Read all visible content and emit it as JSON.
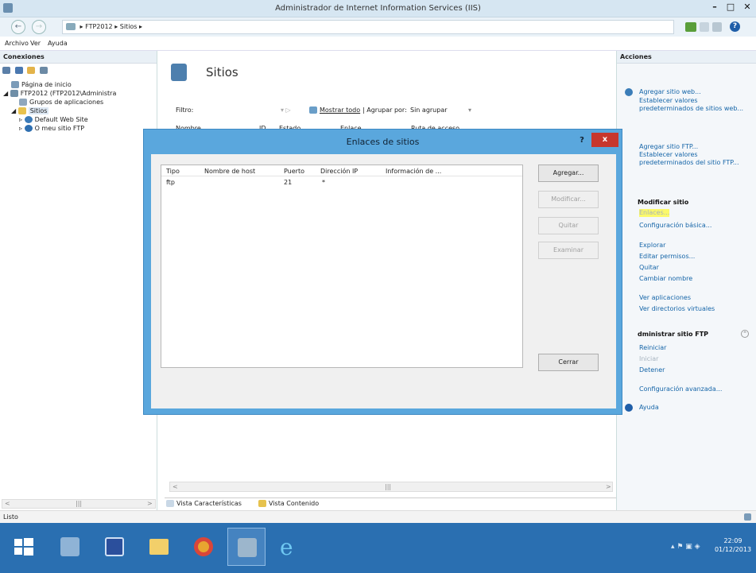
{
  "window": {
    "title": "Administrador de Internet Information Services (IIS)"
  },
  "address": {
    "segments": [
      "FTP2012",
      "Sitios"
    ]
  },
  "menu": [
    "Archivo",
    "Ver",
    "Ayuda"
  ],
  "connections": {
    "header": "Conexiones",
    "tree": [
      "Página de inicio",
      "FTP2012 (FTP2012\\Administra",
      "Grupos de aplicaciones",
      "Sitios",
      "Default Web Site",
      "O meu sitio FTP"
    ]
  },
  "center": {
    "title": "Sitios",
    "filter_label": "Filtro:",
    "show_all": "Mostrar todo",
    "group_by_label": "| Agrupar por:",
    "group_by_value": "Sin agrupar",
    "columns": [
      "Nombre",
      "ID",
      "Estado",
      "Enlace",
      "Ruta de acceso"
    ],
    "tabs": [
      "Vista Características",
      "Vista Contenido"
    ]
  },
  "dialog": {
    "title": "Enlaces de sitios",
    "help": "?",
    "close": "x",
    "columns": [
      "Tipo",
      "Nombre de host",
      "Puerto",
      "Dirección IP",
      "Información de ..."
    ],
    "rows": [
      {
        "type": "ftp",
        "host": "",
        "port": "21",
        "ip": "*",
        "info": ""
      }
    ],
    "buttons": {
      "add": "Agregar...",
      "edit": "Modificar...",
      "remove": "Quitar",
      "browse": "Examinar",
      "close": "Cerrar"
    }
  },
  "actions": {
    "header": "Acciones",
    "add_site": "Agregar sitio web...",
    "web_defaults": "Establecer valores predeterminados de sitios web...",
    "add_ftp": "Agregar sitio FTP...",
    "ftp_defaults": "Establecer valores predeterminados del sitio FTP...",
    "edit_site_header": "Modificar sitio",
    "bindings": "Enlaces...",
    "basic_settings": "Configuración básica...",
    "explore": "Explorar",
    "edit_permissions": "Editar permisos...",
    "remove": "Quitar",
    "rename": "Cambiar nombre",
    "view_apps": "Ver aplicaciones",
    "view_vdirs": "Ver directorios virtuales",
    "manage_ftp_header": "dministrar sitio FTP",
    "restart": "Reiniciar",
    "start": "Iniciar",
    "stop": "Detener",
    "advanced_settings": "Configuración avanzada...",
    "help": "Ayuda"
  },
  "status": {
    "text": "Listo"
  },
  "taskbar": {
    "time": "22:09",
    "date": "01/12/2013"
  },
  "colors": {
    "accent": "#1565a8",
    "dialog_frame": "#5aa7dd",
    "taskbar": "#2a6fb1",
    "highlight": "#fbf96a"
  }
}
